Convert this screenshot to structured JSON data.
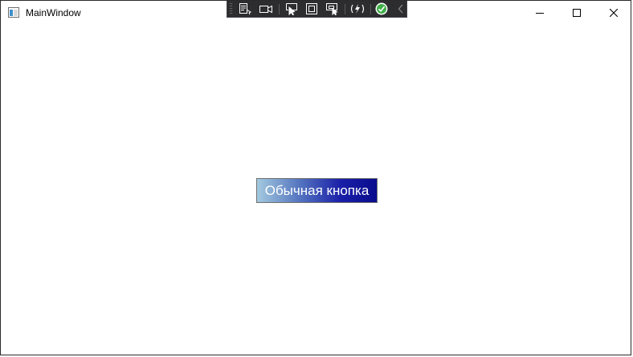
{
  "window": {
    "title": "MainWindow",
    "icon": "window-app-icon"
  },
  "caption_buttons": {
    "minimize_icon": "minimize-icon",
    "maximize_icon": "maximize-icon",
    "close_icon": "close-icon"
  },
  "devtools": {
    "tools": [
      "live-visual-tree-icon",
      "camera-icon",
      "select-element-icon",
      "display-layout-adorners-icon",
      "track-focused-element-icon",
      "hot-reload-icon",
      "hot-reload-status-check-icon",
      "collapse-chevron-icon"
    ]
  },
  "main": {
    "button_label": "Обычная кнопка"
  },
  "colors": {
    "button_gradient_start": "#a3c9df",
    "button_gradient_end": "#0a0c8c",
    "devbar_background": "#2d2d30",
    "status_ok": "#3fae49"
  }
}
